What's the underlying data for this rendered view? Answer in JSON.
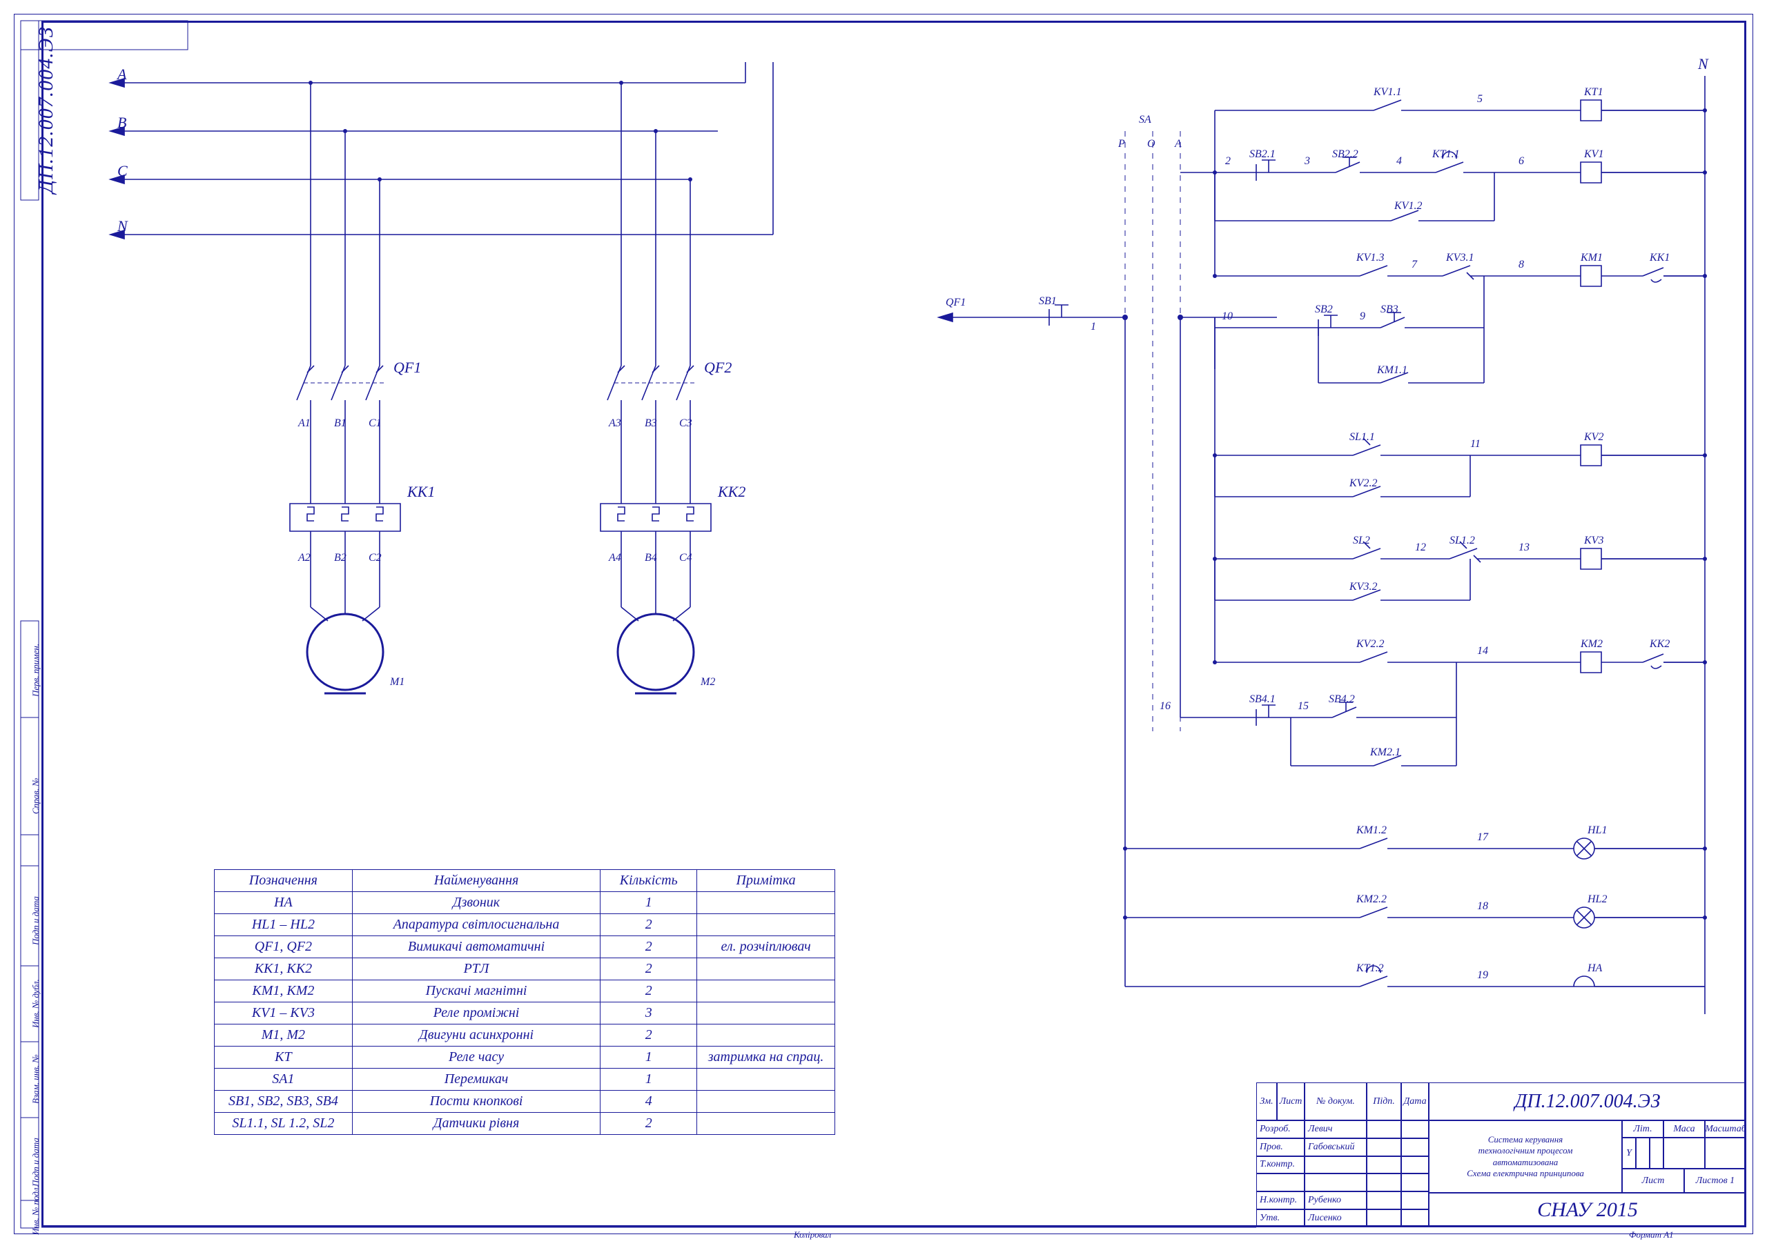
{
  "drawing_number": "ДП.12.007.004.ЭЗ",
  "drawing_number_rev": "ДП.12.007.004.ЭЗ",
  "org": "СНАУ 2015",
  "tb": {
    "title_lines": [
      "Система керування",
      "технологічним процесом",
      "автоматизована",
      "Схема електрична принципова"
    ],
    "cols_left": [
      "Зм.",
      "Лист",
      "№ докум.",
      "Підп.",
      "Дата"
    ],
    "rows_left": [
      [
        "Розроб.",
        "Левич"
      ],
      [
        "Пров.",
        "Габовський"
      ],
      [
        "Т.контр.",
        ""
      ],
      [
        "",
        ""
      ],
      [
        "Н.контр.",
        "Рубенко"
      ],
      [
        "Утв.",
        "Лисенко"
      ]
    ],
    "r_head": [
      "Літ.",
      "Маса",
      "Масштаб"
    ],
    "r_head2": [
      "Y",
      "",
      ""
    ],
    "r_sheet": [
      "Лист",
      "Листов 1"
    ],
    "footer": [
      "Коліровал",
      "",
      "Формат  A1"
    ]
  },
  "side_rows": [
    "Перв. примен.",
    "Справ. №",
    "Подп и дата",
    "Инв. № дубл.",
    "Взам. инв. №",
    "Подп и дата",
    "Инв. № подл."
  ],
  "phases": {
    "A": "A",
    "B": "B",
    "C": "C",
    "N": "N"
  },
  "power_left": {
    "QF1": "QF1",
    "QF2": "QF2",
    "A1": "A1",
    "B1": "B1",
    "C1": "C1",
    "A2": "A2",
    "B2": "B2",
    "C2": "C2",
    "A3": "A3",
    "B3": "B3",
    "C3": "C3",
    "A4": "A4",
    "B4": "B4",
    "C4": "C4",
    "KK1": "KK1",
    "KK2": "KK2",
    "M1": "M1",
    "M2": "M2"
  },
  "ladder": {
    "N": "N",
    "QF1": "QF1",
    "SB1": "SB1",
    "SA": "SA",
    "P": "P",
    "O": "O",
    "A": "A",
    "SB21": "SB2.1",
    "SB22": "SB2.2",
    "KV11": "KV1.1",
    "KT1": "KT1",
    "KT11": "KT1.1",
    "KV1": "KV1",
    "KV12": "KV1.2",
    "KV13": "KV1.3",
    "KV31": "KV3.1",
    "KM1": "KM1",
    "KK1": "KK1",
    "SB2": "SB2",
    "SB3": "SB3",
    "KM11": "KM1.1",
    "SL11": "SL1.1",
    "KV22b": "KV2.2",
    "KV2": "KV2",
    "SL2": "SL2",
    "SL12": "SL1.2",
    "KV32": "KV3.2",
    "KV3": "KV3",
    "KV22": "KV2.2",
    "KM2": "KM2",
    "KK2": "KK2",
    "SB41": "SB4.1",
    "SB42": "SB4.2",
    "KM21": "KM2.1",
    "KM12": "KM1.2",
    "HL1": "HL1",
    "KM22": "KM2.2",
    "HL2": "HL2",
    "KT12": "KT1.2",
    "HA": "HA",
    "n": {
      "1": "1",
      "2": "2",
      "3": "3",
      "4": "4",
      "5": "5",
      "6": "6",
      "7": "7",
      "8": "8",
      "9": "9",
      "10": "10",
      "11": "11",
      "12": "12",
      "13": "13",
      "14": "14",
      "15": "15",
      "16": "16",
      "17": "17",
      "18": "18",
      "19": "19"
    }
  },
  "parts": {
    "head": [
      "Позначення",
      "Найменування",
      "Кількість",
      "Примітка"
    ],
    "rows": [
      [
        "HA",
        "Дзвоник",
        "1",
        ""
      ],
      [
        "HL1 – HL2",
        "Апаратура світлосигнальна",
        "2",
        ""
      ],
      [
        "QF1, QF2",
        "Вимикачі автоматичні",
        "2",
        "ел. розчіплювач"
      ],
      [
        "KK1, KK2",
        "РТЛ",
        "2",
        ""
      ],
      [
        "KM1, KM2",
        "Пускачі магнітні",
        "2",
        ""
      ],
      [
        "KV1 – KV3",
        "Реле проміжні",
        "3",
        ""
      ],
      [
        "M1, M2",
        "Двигуни асинхронні",
        "2",
        ""
      ],
      [
        "KT",
        "Реле часу",
        "1",
        "затримка на спрац."
      ],
      [
        "SA1",
        "Перемикач",
        "1",
        ""
      ],
      [
        "SB1, SB2, SB3, SB4",
        "Пости кнопкові",
        "4",
        ""
      ],
      [
        "SL1.1, SL 1.2, SL2",
        "Датчики рівня",
        "2",
        ""
      ]
    ]
  }
}
